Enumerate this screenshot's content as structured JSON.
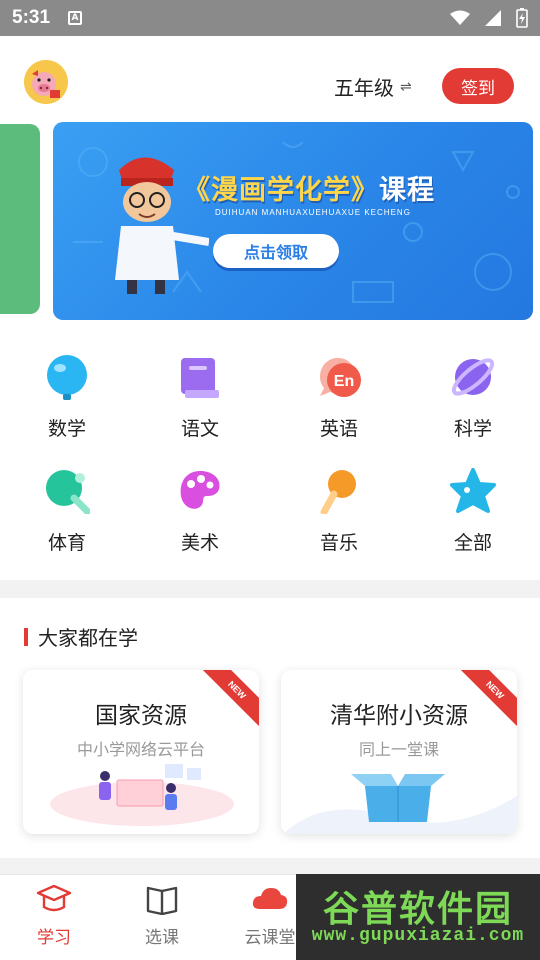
{
  "status_bar": {
    "time": "5:31",
    "notification_letter": "A"
  },
  "header": {
    "grade": "五年级",
    "grade_swap_glyph": "⇌",
    "signin_label": "签到"
  },
  "banner": {
    "title_main": "《漫画学化学》",
    "title_suffix": "课程",
    "pinyin": "DUIHUAN MANHUAXUEHUAXUE KECHENG",
    "cta_label": "点击领取"
  },
  "subjects": [
    {
      "label": "数学",
      "icon": "math-icon",
      "color": "#2ab6f2"
    },
    {
      "label": "语文",
      "icon": "book-icon",
      "color": "#9b6cf0"
    },
    {
      "label": "英语",
      "icon": "english-bubble-icon",
      "color": "#f05a4a"
    },
    {
      "label": "科学",
      "icon": "planet-icon",
      "color": "#8a63ee"
    },
    {
      "label": "体育",
      "icon": "pingpong-icon",
      "color": "#25c49a"
    },
    {
      "label": "美术",
      "icon": "palette-icon",
      "color": "#d94fe0"
    },
    {
      "label": "音乐",
      "icon": "microphone-icon",
      "color": "#f59a28"
    },
    {
      "label": "全部",
      "icon": "star-icon",
      "color": "#25b6e8"
    }
  ],
  "popular": {
    "section_title": "大家都在学",
    "cards": [
      {
        "title": "国家资源",
        "subtitle": "中小学网络云平台",
        "badge": "NEW"
      },
      {
        "title": "清华附小资源",
        "subtitle": "同上一堂课",
        "badge": "NEW"
      }
    ]
  },
  "bottom_nav": [
    {
      "label": "学习",
      "icon": "graduation-cap-icon",
      "active": true
    },
    {
      "label": "选课",
      "icon": "open-book-icon",
      "active": false
    },
    {
      "label": "云课堂",
      "icon": "cloud-icon",
      "active": false
    }
  ],
  "watermark": {
    "line1": "谷普软件园",
    "line2": "www.gupuxiazai.com"
  },
  "colors": {
    "accent": "#e23b36",
    "banner_blue": "#2a86e8",
    "banner_title": "#ffd64a"
  }
}
